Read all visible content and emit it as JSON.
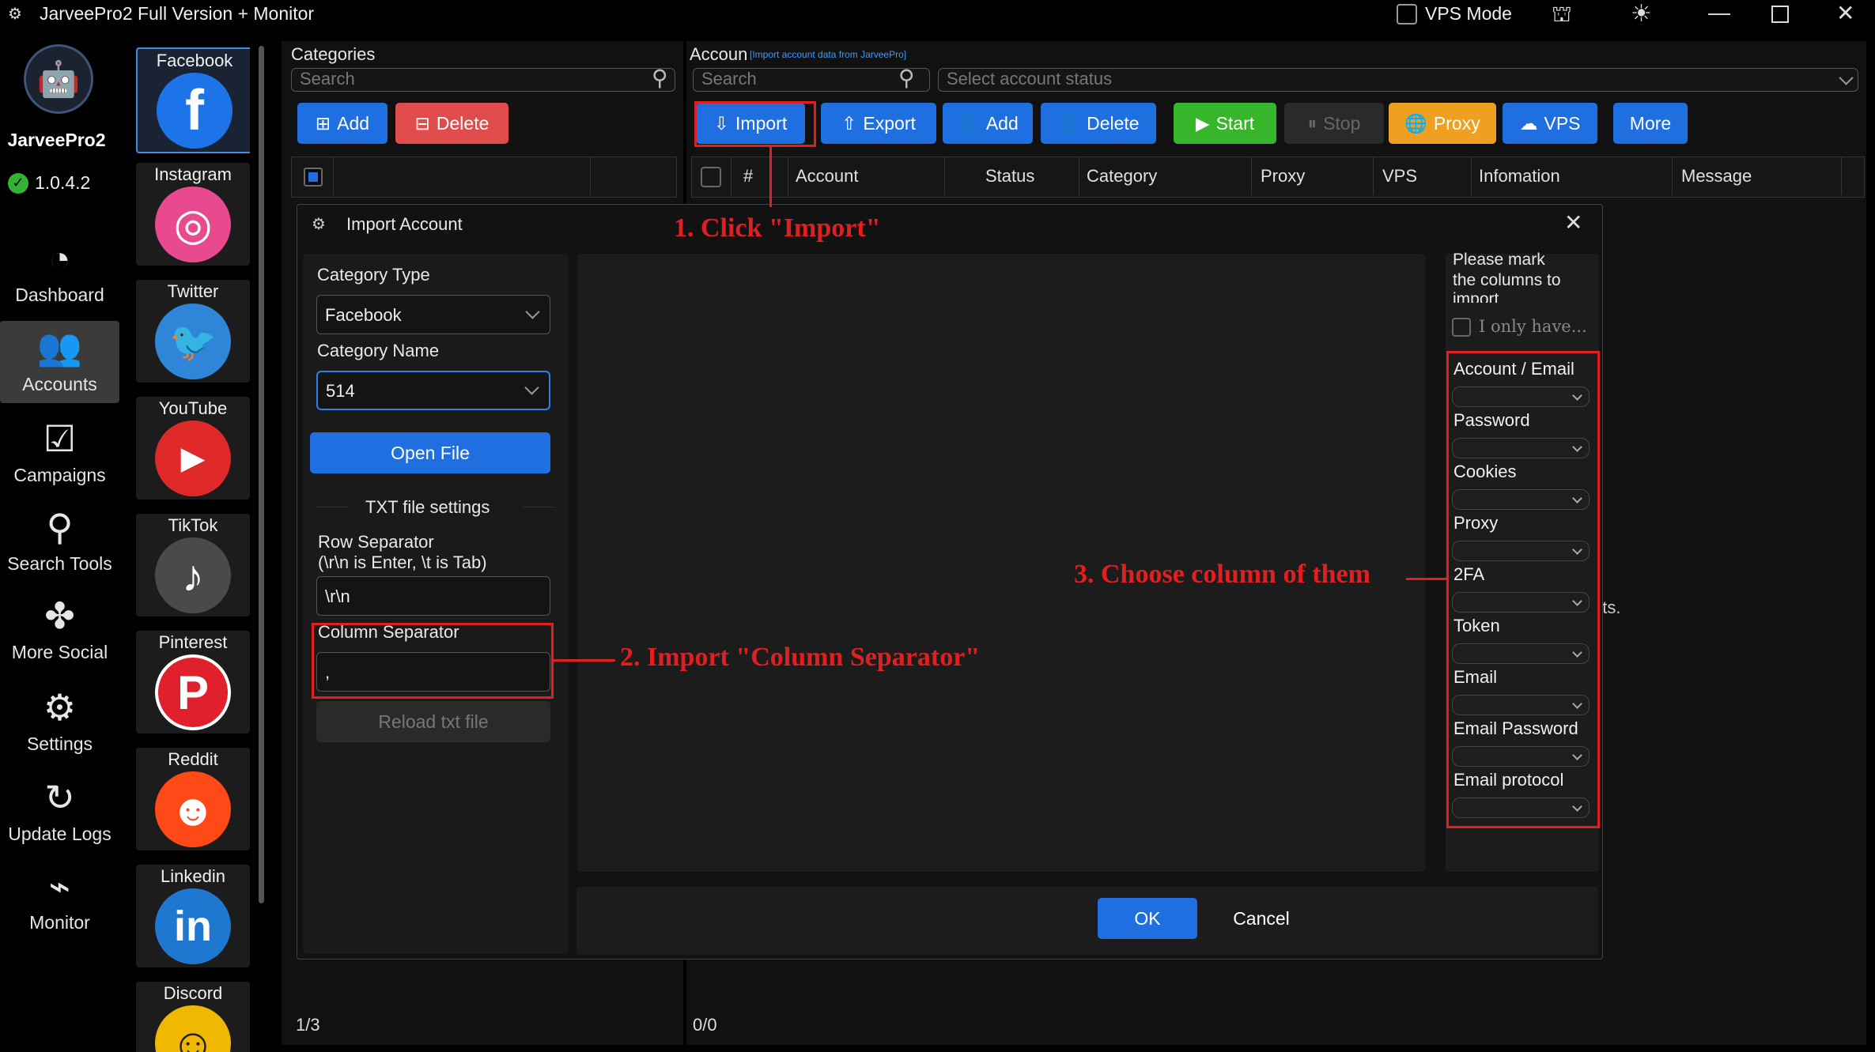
{
  "window": {
    "title": "JarveePro2 Full Version + Monitor",
    "vps_mode_label": "VPS Mode"
  },
  "app": {
    "name": "JarveePro2",
    "version": "1.0.4.2"
  },
  "nav": [
    {
      "label": "Dashboard"
    },
    {
      "label": "Accounts"
    },
    {
      "label": "Campaigns"
    },
    {
      "label": "Search Tools"
    },
    {
      "label": "More Social"
    },
    {
      "label": "Settings"
    },
    {
      "label": "Update Logs"
    },
    {
      "label": "Monitor"
    }
  ],
  "social": [
    {
      "label": "Facebook",
      "glyph": "f"
    },
    {
      "label": "Instagram",
      "glyph": "◎"
    },
    {
      "label": "Twitter",
      "glyph": "🐦"
    },
    {
      "label": "YouTube",
      "glyph": "▶"
    },
    {
      "label": "TikTok",
      "glyph": "♪"
    },
    {
      "label": "Pinterest",
      "glyph": "P"
    },
    {
      "label": "Reddit",
      "glyph": "☻"
    },
    {
      "label": "Linkedin",
      "glyph": "in"
    },
    {
      "label": "Discord",
      "glyph": "☺"
    }
  ],
  "categories": {
    "title": "Categories",
    "search_placeholder": "Search",
    "add_label": "Add",
    "delete_label": "Delete",
    "pager": "1/3"
  },
  "accounts": {
    "title": "Accoun",
    "import_hint": "[Import account data from JarveePro]",
    "search_placeholder": "Search",
    "status_placeholder": "Select account status",
    "buttons": {
      "import": "Import",
      "export": "Export",
      "add": "Add",
      "delete": "Delete",
      "start": "Start",
      "stop": "Stop",
      "proxy": "Proxy",
      "vps": "VPS",
      "more": "More"
    },
    "columns": [
      "#",
      "Account",
      "Status",
      "Category",
      "Proxy",
      "VPS",
      "Infomation",
      "Message"
    ],
    "pager": "0/0",
    "partial_text": "nts."
  },
  "dialog": {
    "title": "Import Account",
    "category_type_label": "Category Type",
    "category_type_value": "Facebook",
    "category_name_label": "Category Name",
    "category_name_value": "514",
    "open_file_label": "Open File",
    "txt_settings_label": "TXT file settings",
    "row_sep_label": "Row Separator",
    "row_sep_hint": "(\\r\\n is Enter, \\t is Tab)",
    "row_sep_value": "\\r\\n",
    "col_sep_label": "Column Separator",
    "col_sep_value": ",",
    "reload_label": "Reload txt file",
    "mark_note_1": "Please mark",
    "mark_note_2": "the columns to",
    "mark_note_3": "import",
    "only_have_label": "I only have...",
    "columns": [
      "Account / Email",
      "Password",
      "Cookies",
      "Proxy",
      "2FA",
      "Token",
      "Email",
      "Email Password",
      "Email protocol"
    ],
    "ok_label": "OK",
    "cancel_label": "Cancel"
  },
  "annotations": {
    "step1": "1. Click \"Import\"",
    "step2": "2. Import \"Column Separator\"",
    "step3": "3. Choose column of them"
  },
  "colors": {
    "accent_blue": "#1f6fe0",
    "delete_red": "#e04c4c",
    "start_green": "#37b52b",
    "proxy_orange": "#f0a020",
    "annotation_red": "#e02020"
  }
}
